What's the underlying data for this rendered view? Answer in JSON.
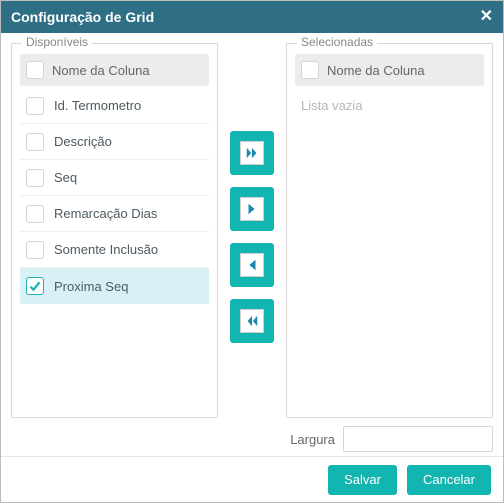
{
  "dialog": {
    "title": "Configuração de Grid"
  },
  "available": {
    "legend": "Disponíveis",
    "header_label": "Nome da Coluna",
    "items": [
      {
        "label": "Id. Termometro",
        "checked": false
      },
      {
        "label": "Descrição",
        "checked": false
      },
      {
        "label": "Seq",
        "checked": false
      },
      {
        "label": "Remarcação Dias",
        "checked": false
      },
      {
        "label": "Somente Inclusão",
        "checked": false
      },
      {
        "label": "Proxima Seq",
        "checked": true
      }
    ]
  },
  "selected": {
    "legend": "Selecionadas",
    "header_label": "Nome da Coluna",
    "empty_text": "Lista vazia",
    "items": []
  },
  "transfer": {
    "add_all": "move-all-right",
    "add_one": "move-right",
    "remove_one": "move-left",
    "remove_all": "move-all-left"
  },
  "width_field": {
    "label": "Largura",
    "value": ""
  },
  "footer": {
    "save_label": "Salvar",
    "cancel_label": "Cancelar"
  }
}
